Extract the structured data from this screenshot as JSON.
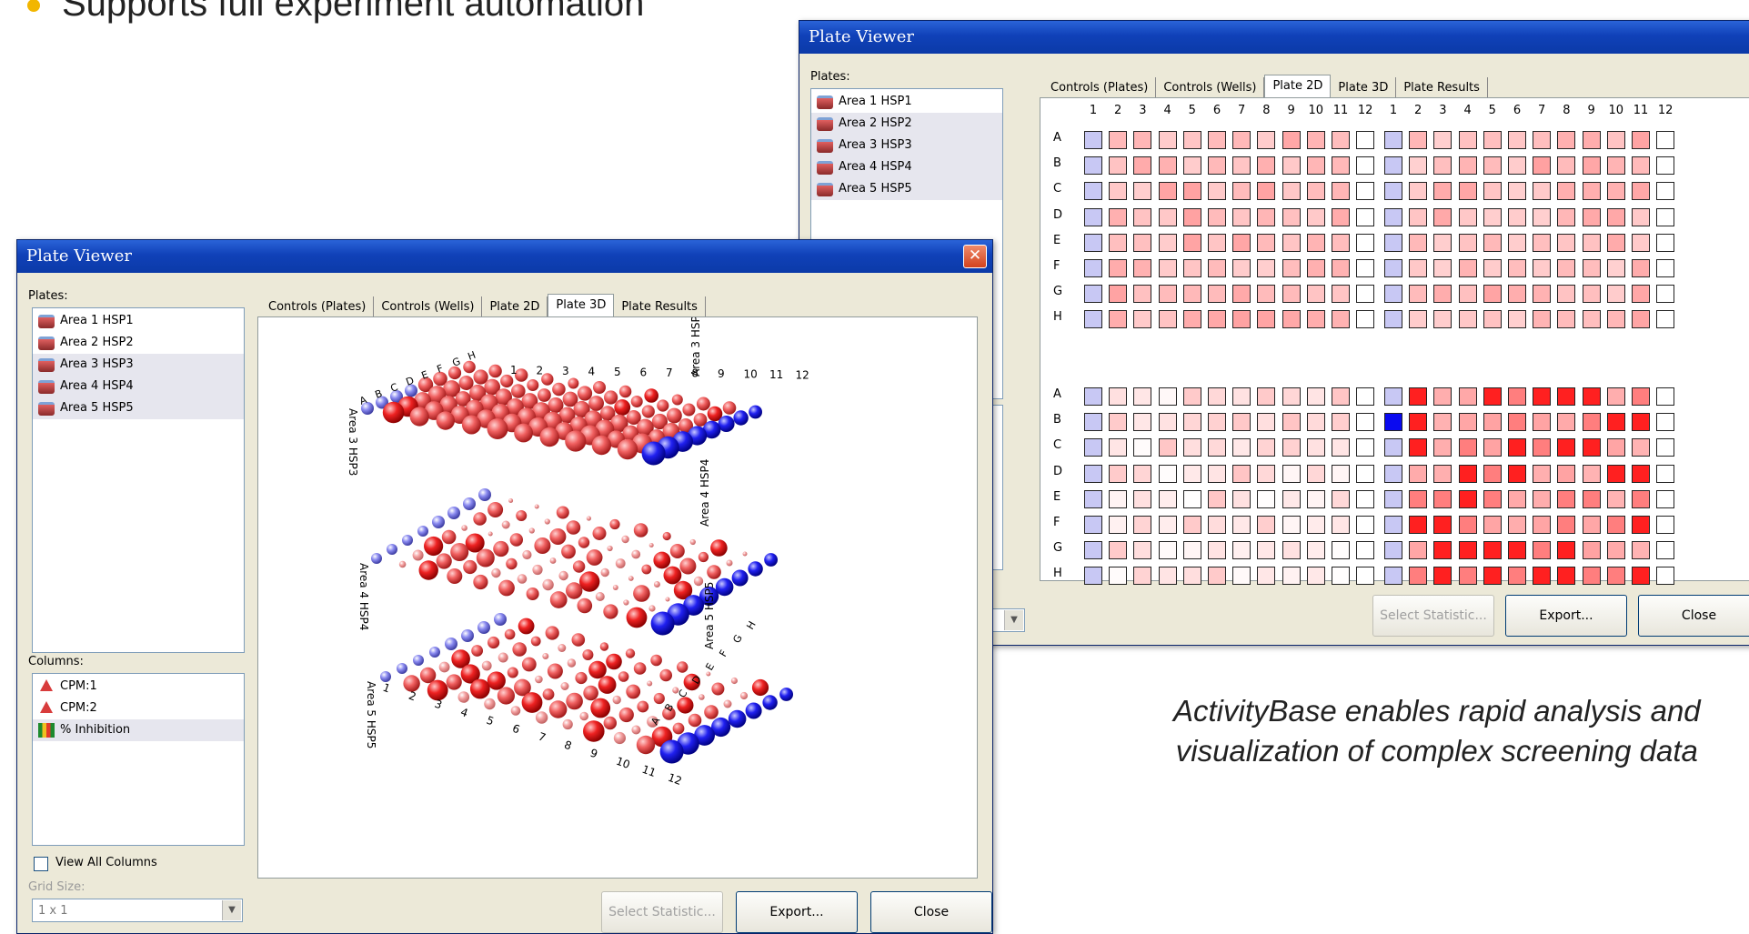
{
  "slide": {
    "bullet": "Supports full experiment automation",
    "caption_line1": "ActivityBase enables rapid analysis and",
    "caption_line2": "visualization of complex screening data"
  },
  "colors": {
    "titlebar": "#0b3aa8",
    "control_blue": "#1a1aff",
    "hit_red": "#e81010"
  },
  "back_window": {
    "title": "Plate Viewer",
    "plates_label": "Plates:",
    "plates": [
      "Area 1 HSP1",
      "Area 2 HSP2",
      "Area 3 HSP3",
      "Area 4 HSP4",
      "Area 5 HSP5"
    ],
    "tabs": [
      "Controls (Plates)",
      "Controls (Wells)",
      "Plate 2D",
      "Plate 3D",
      "Plate Results"
    ],
    "active_tab": "Plate 2D",
    "col_labels": [
      "1",
      "2",
      "3",
      "4",
      "5",
      "6",
      "7",
      "8",
      "9",
      "10",
      "11",
      "12"
    ],
    "row_labels": [
      "A",
      "B",
      "C",
      "D",
      "E",
      "F",
      "G",
      "H"
    ],
    "buttons": {
      "select_statistic": "Select Statistic...",
      "export": "Export...",
      "close": "Close"
    }
  },
  "front_window": {
    "title": "Plate Viewer",
    "close_icon": "close-icon",
    "plates_label": "Plates:",
    "plates": [
      "Area 1 HSP1",
      "Area 2 HSP2",
      "Area 3 HSP3",
      "Area 4 HSP4",
      "Area 5 HSP5"
    ],
    "tabs": [
      "Controls (Plates)",
      "Controls (Wells)",
      "Plate 2D",
      "Plate 3D",
      "Plate Results"
    ],
    "active_tab": "Plate 3D",
    "columns_label": "Columns:",
    "columns": [
      "CPM:1",
      "CPM:2",
      "% Inhibition"
    ],
    "view_all_columns": "View All Columns",
    "grid_size_label": "Grid Size:",
    "grid_size_value": "1 x 1",
    "plot_labels": {
      "plate1": "Area 3 HSP3",
      "plate2": "Area 4 HSP4",
      "plate3": "Area 5 HSP5",
      "row_letters": [
        "A",
        "B",
        "C",
        "D",
        "E",
        "F",
        "G",
        "H"
      ],
      "col_numbers": [
        "1",
        "2",
        "3",
        "4",
        "5",
        "6",
        "7",
        "8",
        "9",
        "10",
        "11",
        "12"
      ]
    },
    "buttons": {
      "select_statistic": "Select Statistic...",
      "export": "Export...",
      "close": "Close"
    }
  }
}
